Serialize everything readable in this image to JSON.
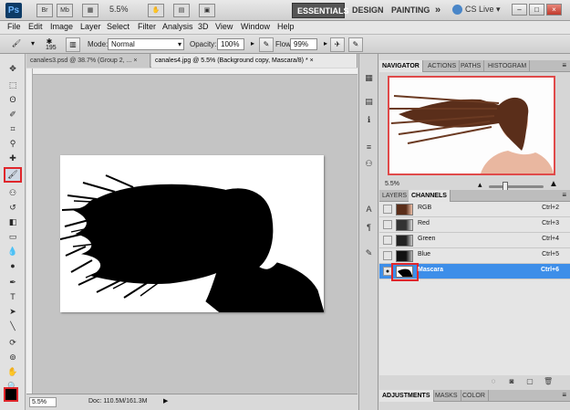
{
  "app_bar": {
    "logo": "Ps",
    "icons": [
      "Br",
      "Mb"
    ],
    "zoom": "5.5%",
    "workspaces": [
      "ESSENTIALS",
      "DESIGN",
      "PAINTING"
    ],
    "more": "»",
    "cs_live": "CS Live",
    "window_controls": [
      "–",
      "□",
      "×"
    ]
  },
  "menu": [
    "File",
    "Edit",
    "Image",
    "Layer",
    "Select",
    "Filter",
    "Analysis",
    "3D",
    "View",
    "Window",
    "Help"
  ],
  "options_bar": {
    "brush_size": "195",
    "mode_label": "Mode:",
    "mode_value": "Normal",
    "opacity_label": "Opacity:",
    "opacity_value": "100%",
    "flow_label": "Flow:",
    "flow_value": "99%"
  },
  "tabs": [
    {
      "label": "canales3.psd @ 38.7% (Group 2, ...",
      "close": "×"
    },
    {
      "label": "canales4.jpg @ 5.5% (Background copy, Mascara/8) *",
      "close": "×"
    }
  ],
  "status": {
    "zoom": "5.5%",
    "doc": "Doc: 110.5M/161.3M",
    "arrow": "▶"
  },
  "navigator": {
    "tabs": [
      "NAVIGATOR",
      "ACTIONS",
      "PATHS",
      "HISTOGRAM"
    ],
    "zoom": "5.5%"
  },
  "channels": {
    "tabs": [
      "LAYERS",
      "CHANNELS"
    ],
    "rows": [
      {
        "name": "RGB",
        "shortcut": "Ctrl+2"
      },
      {
        "name": "Red",
        "shortcut": "Ctrl+3"
      },
      {
        "name": "Green",
        "shortcut": "Ctrl+4"
      },
      {
        "name": "Blue",
        "shortcut": "Ctrl+5"
      },
      {
        "name": "Mascara",
        "shortcut": "Ctrl+6"
      }
    ]
  },
  "adjustments": {
    "tabs": [
      "ADJUSTMENTS",
      "MASKS",
      "COLOR"
    ]
  },
  "colors": {
    "highlight_red": "#e0262b",
    "selection_blue": "#3d8ee9"
  }
}
